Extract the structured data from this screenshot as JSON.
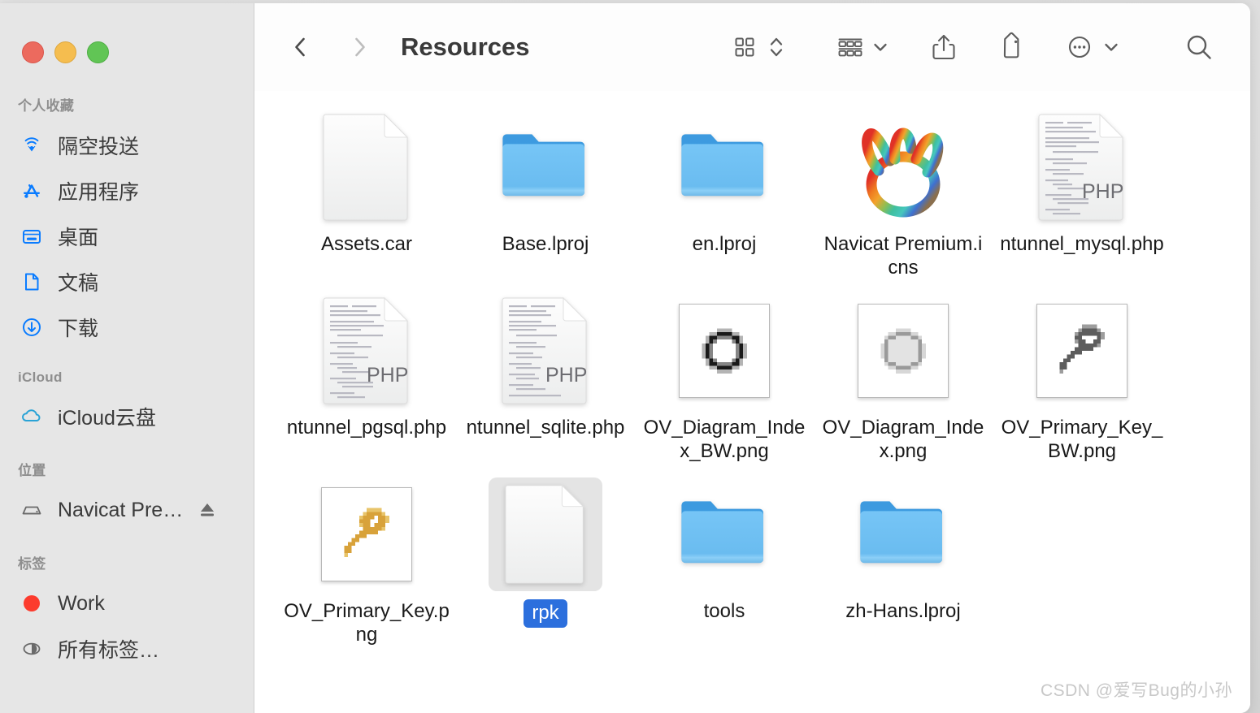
{
  "window": {
    "traffic_lights": [
      {
        "name": "close",
        "color": "#ec6a5e"
      },
      {
        "name": "minimize",
        "color": "#f5bd4f"
      },
      {
        "name": "zoom",
        "color": "#61c555"
      }
    ]
  },
  "toolbar": {
    "back_label": "‹",
    "forward_label": "›",
    "title": "Resources",
    "view_icon": "grid-view-icon",
    "view_sort_icon": "sort-chevrons-icon",
    "group_icon": "group-by-icon",
    "group_chevron": "chevron-down-icon",
    "share_icon": "share-icon",
    "tag_icon": "tag-icon",
    "more_icon": "more-ellipsis-icon",
    "more_chevron": "chevron-down-icon",
    "search_icon": "search-icon"
  },
  "sidebar": {
    "groups": [
      {
        "header": "个人收藏",
        "items": [
          {
            "label": "隔空投送",
            "icon": "airdrop-icon"
          },
          {
            "label": "应用程序",
            "icon": "applications-icon"
          },
          {
            "label": "桌面",
            "icon": "desktop-icon"
          },
          {
            "label": "文稿",
            "icon": "documents-icon"
          },
          {
            "label": "下载",
            "icon": "downloads-icon"
          }
        ]
      },
      {
        "header": "iCloud",
        "items": [
          {
            "label": "iCloud云盘",
            "icon": "icloud-drive-icon"
          }
        ]
      },
      {
        "header": "位置",
        "items": [
          {
            "label": "Navicat Pre…",
            "icon": "external-disk-icon",
            "eject": true
          }
        ]
      },
      {
        "header": "标签",
        "items": [
          {
            "label": "Work",
            "icon": "tag-dot-red",
            "color": "#fc3b2d"
          },
          {
            "label": "所有标签…",
            "icon": "all-tags-icon"
          }
        ]
      }
    ]
  },
  "files": [
    {
      "name": "Assets.car",
      "kind": "doc-plain",
      "selected": false
    },
    {
      "name": "Base.lproj",
      "kind": "folder",
      "selected": false
    },
    {
      "name": "en.lproj",
      "kind": "folder",
      "selected": false
    },
    {
      "name": "Navicat Premium.icns",
      "kind": "navicat-icns",
      "selected": false
    },
    {
      "name": "ntunnel_mysql.php",
      "kind": "doc-php",
      "selected": false
    },
    {
      "name": "ntunnel_pgsql.php",
      "kind": "doc-php",
      "selected": false
    },
    {
      "name": "ntunnel_sqlite.php",
      "kind": "doc-php",
      "selected": false
    },
    {
      "name": "OV_Diagram_Index_BW.png",
      "kind": "png-diamond-bw",
      "selected": false
    },
    {
      "name": "OV_Diagram_Index.png",
      "kind": "png-diamond-gray",
      "selected": false
    },
    {
      "name": "OV_Primary_Key_BW.png",
      "kind": "png-key-gray",
      "selected": false
    },
    {
      "name": "OV_Primary_Key.png",
      "kind": "png-key-gold",
      "selected": false
    },
    {
      "name": "rpk",
      "kind": "doc-plain",
      "selected": true
    },
    {
      "name": "tools",
      "kind": "folder",
      "selected": false
    },
    {
      "name": "zh-Hans.lproj",
      "kind": "folder",
      "selected": false
    }
  ],
  "watermark": "CSDN @爱写Bug的小孙",
  "colors": {
    "sidebar_bg": "#e6e6e6",
    "content_bg": "#ffffff",
    "accent_blue": "#0a7cff",
    "selection_blue": "#2c6fdd",
    "folder_blue": "#6cc0f3"
  }
}
